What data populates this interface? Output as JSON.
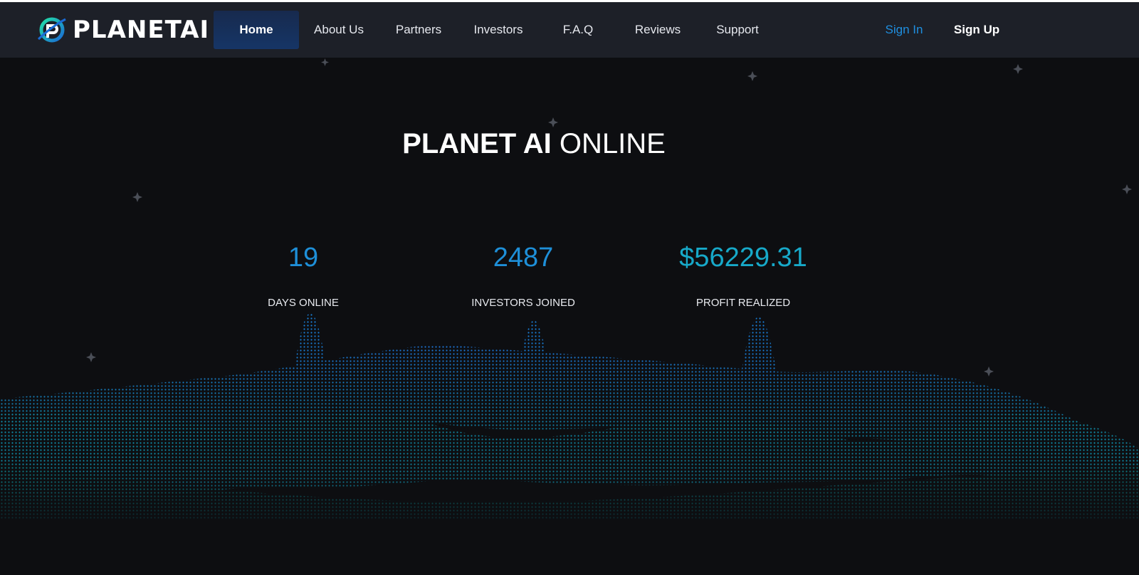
{
  "brand": {
    "name": "PLANETAI",
    "logo_icon": "planet-p-logo-icon"
  },
  "nav": {
    "items": [
      {
        "label": "Home"
      },
      {
        "label": "About Us"
      },
      {
        "label": "Partners"
      },
      {
        "label": "Investors"
      },
      {
        "label": "F.A.Q"
      },
      {
        "label": "Reviews"
      },
      {
        "label": "Support"
      }
    ],
    "active": "Home",
    "sign_in": "Sign In",
    "sign_up": "Sign Up"
  },
  "hero": {
    "title_bold": "PLANET AI",
    "title_light": "ONLINE"
  },
  "stats": [
    {
      "value": "19",
      "label": "DAYS ONLINE"
    },
    {
      "value": "2487",
      "label": "INVESTORS JOINED"
    },
    {
      "value": "$56229.31",
      "label": "PROFIT REALIZED"
    }
  ],
  "colors": {
    "accent_blue": "#1e8fd8",
    "accent_teal": "#13b6c9",
    "nav_bg": "#1d2028",
    "page_bg": "#0d0e11"
  }
}
